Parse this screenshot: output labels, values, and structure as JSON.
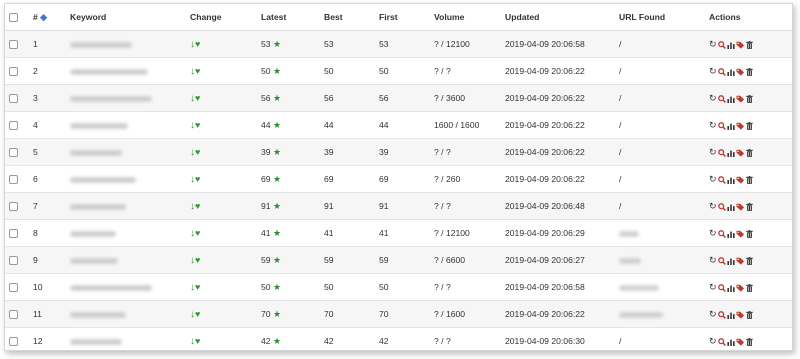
{
  "table": {
    "headers": {
      "number": "#",
      "keyword": "Keyword",
      "change": "Change",
      "latest": "Latest",
      "best": "Best",
      "first": "First",
      "volume": "Volume",
      "updated": "Updated",
      "url_found": "URL Found",
      "actions": "Actions"
    },
    "rows": [
      {
        "num": "1",
        "latest": "53",
        "best": "53",
        "first": "53",
        "volume": "? / 12100",
        "updated": "2019-04-09 20:06:58",
        "url": "/"
      },
      {
        "num": "2",
        "latest": "50",
        "best": "50",
        "first": "50",
        "volume": "? / ?",
        "updated": "2019-04-09 20:06:22",
        "url": "/"
      },
      {
        "num": "3",
        "latest": "56",
        "best": "56",
        "first": "56",
        "volume": "? / 3600",
        "updated": "2019-04-09 20:06:22",
        "url": "/"
      },
      {
        "num": "4",
        "latest": "44",
        "best": "44",
        "first": "44",
        "volume": "1600 / 1600",
        "updated": "2019-04-09 20:06:22",
        "url": "/"
      },
      {
        "num": "5",
        "latest": "39",
        "best": "39",
        "first": "39",
        "volume": "? / ?",
        "updated": "2019-04-09 20:06:22",
        "url": "/"
      },
      {
        "num": "6",
        "latest": "69",
        "best": "69",
        "first": "69",
        "volume": "? / 260",
        "updated": "2019-04-09 20:06:22",
        "url": "/"
      },
      {
        "num": "7",
        "latest": "91",
        "best": "91",
        "first": "91",
        "volume": "? / ?",
        "updated": "2019-04-09 20:06:48",
        "url": "/"
      },
      {
        "num": "8",
        "latest": "41",
        "best": "41",
        "first": "41",
        "volume": "? / 12100",
        "updated": "2019-04-09 20:06:29",
        "url": ""
      },
      {
        "num": "9",
        "latest": "59",
        "best": "59",
        "first": "59",
        "volume": "? / 6600",
        "updated": "2019-04-09 20:06:27",
        "url": ""
      },
      {
        "num": "10",
        "latest": "50",
        "best": "50",
        "first": "50",
        "volume": "? / ?",
        "updated": "2019-04-09 20:06:58",
        "url": ""
      },
      {
        "num": "11",
        "latest": "70",
        "best": "70",
        "first": "70",
        "volume": "? / 1600",
        "updated": "2019-04-09 20:06:22",
        "url": ""
      },
      {
        "num": "12",
        "latest": "42",
        "best": "42",
        "first": "42",
        "volume": "? / ?",
        "updated": "2019-04-09 20:06:30",
        "url": "/"
      }
    ]
  },
  "icons": {
    "change_arrow": "arrow-down-icon",
    "change_heart": "heart-icon",
    "rank_star": "star-icon",
    "actions": [
      "refresh-icon",
      "search-icon",
      "chart-icon",
      "tag-icon",
      "trash-icon"
    ]
  },
  "colors": {
    "accent_green": "#2e8b2e",
    "accent_red": "#c0392b",
    "row_stripe": "#f6f6f6"
  }
}
